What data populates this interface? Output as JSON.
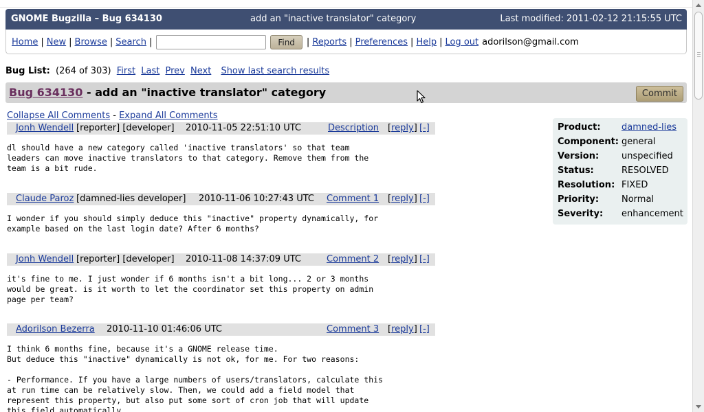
{
  "header": {
    "left": "GNOME Bugzilla – Bug 634130",
    "middle": "add an \"inactive translator\" category",
    "right": "Last modified: 2011-02-12 21:15:55 UTC"
  },
  "nav": {
    "home": "Home",
    "new": "New",
    "browse": "Browse",
    "search": "Search",
    "search_value": "",
    "find": "Find",
    "reports": "Reports",
    "preferences": "Preferences",
    "help": "Help",
    "logout": "Log out",
    "user": "adorilson@gmail.com"
  },
  "buglist": {
    "label": "Bug List:",
    "count": "(264 of 303)",
    "first": "First",
    "last": "Last",
    "prev": "Prev",
    "next": "Next",
    "show_last": "Show last search results"
  },
  "title": {
    "bug_link": "Bug 634130",
    "summary": " - add an \"inactive translator\" category",
    "commit": "Commit"
  },
  "collapse": {
    "collapse_all": "Collapse All Comments",
    "dash": "-",
    "expand_all": "Expand All Comments"
  },
  "comments": [
    {
      "author": "Jonh Wendell",
      "roles": "[reporter] [developer]",
      "time": "2010-11-05 22:51:10 UTC",
      "label": "Description",
      "reply": "reply",
      "collapse": "[-]",
      "text": "dl should have a new category called 'inactive translators' so that team\nleaders can move inactive translators to that category. Remove them from the\nteam is a bit rude."
    },
    {
      "author": "Claude Paroz",
      "roles": "[damned-lies developer]",
      "time": "2010-11-06 10:27:43 UTC",
      "label": "Comment 1",
      "reply": "reply",
      "collapse": "[-]",
      "text": "I wonder if you should simply deduce this \"inactive\" property dynamically, for\nexample based on the last login date? After 6 months?"
    },
    {
      "author": "Jonh Wendell",
      "roles": "[reporter] [developer]",
      "time": "2010-11-08 14:37:09 UTC",
      "label": "Comment 2",
      "reply": "reply",
      "collapse": "[-]",
      "text": "it's fine to me. I just wonder if 6 months isn't a bit long... 2 or 3 months\nwould be great. is it worth to let the coordinator set this property on admin\npage per team?"
    },
    {
      "author": "Adorilson Bezerra",
      "roles": "",
      "time": "2010-11-10 01:46:06 UTC",
      "label": "Comment 3",
      "reply": "reply",
      "collapse": "[-]",
      "text": "I think 6 months fine, because it's a GNOME release time.\nBut deduce this \"inactive\" dynamically is not ok, for me. For two reasons:\n\n- Performance. If you have a large numbers of users/translators, calculate this\nat run time can be relatively slow. Then, we could add a field model that\nrepresent this property, but also put some sort of cron job that will update\nthis field automatically."
    }
  ],
  "fields": [
    {
      "key": "Product:",
      "value": "damned-lies"
    },
    {
      "key": "Component:",
      "value": "general"
    },
    {
      "key": "Version:",
      "value": "unspecified"
    },
    {
      "key": "Status:",
      "value": "RESOLVED"
    },
    {
      "key": "Resolution:",
      "value": "FIXED"
    },
    {
      "key": "Priority:",
      "value": "Normal"
    },
    {
      "key": "Severity:",
      "value": "enhancement"
    }
  ]
}
